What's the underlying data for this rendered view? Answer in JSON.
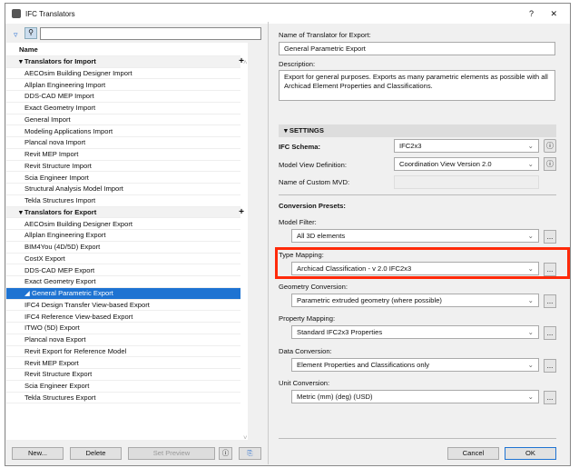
{
  "window": {
    "title": "IFC Translators",
    "help": "?",
    "close": "✕"
  },
  "left": {
    "search_value": "",
    "column_header": "Name",
    "import_group": "Translators for Import",
    "import_items": [
      "AECOsim Building Designer Import",
      "Allplan Engineering Import",
      "DDS-CAD MEP Import",
      "Exact Geometry Import",
      "General Import",
      "Modeling Applications Import",
      "Plancal nova Import",
      "Revit MEP Import",
      "Revit Structure Import",
      "Scia Engineer Import",
      "Structural Analysis Model Import",
      "Tekla Structures Import"
    ],
    "export_group": "Translators for Export",
    "export_items": [
      "AECOsim Building Designer Export",
      "Allplan Engineering Export",
      "BIM4You (4D/5D) Export",
      "CostX Export",
      "DDS-CAD MEP Export",
      "Exact Geometry Export",
      "General Parametric Export",
      "IFC4 Design Transfer View-based Export",
      "IFC4 Reference View-based Export",
      "ITWO (5D) Export",
      "Plancal nova Export",
      "Revit Export for Reference Model",
      "Revit MEP Export",
      "Revit Structure Export",
      "Scia Engineer Export",
      "Tekla Structures Export"
    ],
    "selected": "General Parametric Export",
    "buttons": {
      "new": "New...",
      "delete": "Delete",
      "set_preview": "Set Preview"
    }
  },
  "right": {
    "name_label": "Name of Translator for Export:",
    "name_value": "General Parametric Export",
    "desc_label": "Description:",
    "desc_value": "Export for general purposes. Exports as many parametric elements as possible with all Archicad Element Properties and Classifications.",
    "settings": "SETTINGS",
    "schema_label": "IFC Schema:",
    "schema_value": "IFC2x3",
    "mvd_label": "Model View Definition:",
    "mvd_value": "Coordination View Version 2.0",
    "custom_mvd_label": "Name of Custom MVD:",
    "presets_label": "Conversion Presets:",
    "model_filter_label": "Model Filter:",
    "model_filter_value": "All 3D elements",
    "type_mapping_label": "Type Mapping:",
    "type_mapping_value": "Archicad Classification - v 2.0 IFC2x3",
    "geometry_label": "Geometry Conversion:",
    "geometry_value": "Parametric extruded geometry (where possible)",
    "property_label": "Property Mapping:",
    "property_value": "Standard IFC2x3 Properties",
    "data_label": "Data Conversion:",
    "data_value": "Element Properties and Classifications only",
    "unit_label": "Unit Conversion:",
    "unit_value": "Metric (mm) (deg) (USD)",
    "cancel": "Cancel",
    "ok": "OK",
    "more": "...",
    "chevron": "⌄"
  },
  "colors": {
    "highlight": "#ff2a0a",
    "selection": "#1e73d2"
  }
}
